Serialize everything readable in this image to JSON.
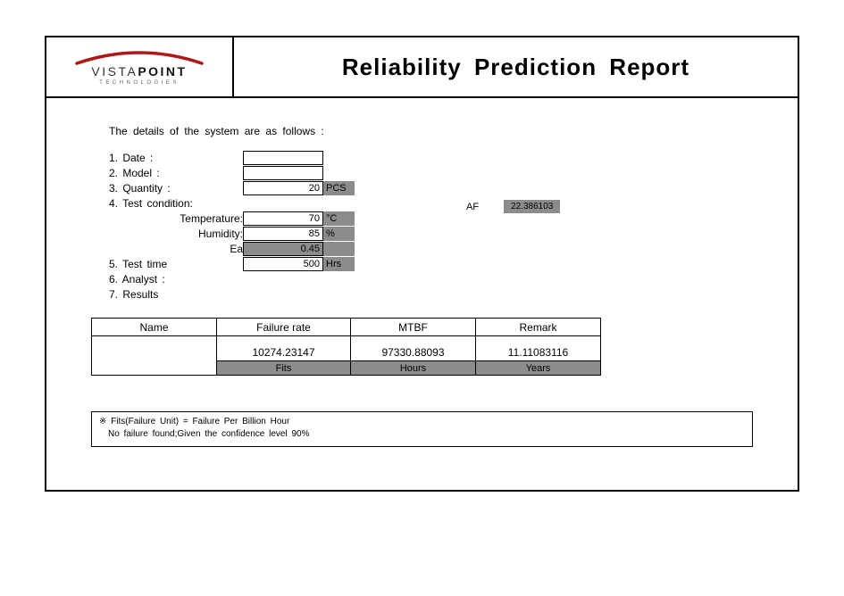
{
  "logo": {
    "brand_prefix": "VISTA",
    "brand_suffix": "POINT",
    "sub": "TECHNOLOGIES"
  },
  "title": "Reliability Prediction Report",
  "intro": "The details of the system are as follows :",
  "details": {
    "date": {
      "label": "1. Date :",
      "value": ""
    },
    "model": {
      "label": "2. Model :",
      "value": ""
    },
    "quantity": {
      "label": "3. Quantity :",
      "value": "20",
      "unit": "PCS"
    },
    "testcond": {
      "label": "4. Test condition:"
    },
    "temperature": {
      "label": "Temperature:",
      "value": "70",
      "unit": "°C"
    },
    "humidity": {
      "label": "Humidity:",
      "value": "85",
      "unit": "%"
    },
    "ea": {
      "label": "Ea",
      "value": "0.45"
    },
    "testtime": {
      "label": "5. Test time",
      "value": "500",
      "unit": "Hrs"
    },
    "analyst": {
      "label": "6. Analyst :"
    },
    "results": {
      "label": "7. Results"
    },
    "af": {
      "label": "AF",
      "value": "22.386103"
    }
  },
  "table": {
    "headers": {
      "name": "Name",
      "failure": "Failure rate",
      "mtbf": "MTBF",
      "remark": "Remark"
    },
    "values": {
      "name": "",
      "failure": "10274.23147",
      "mtbf": "97330.88093",
      "remark": "11.11083116"
    },
    "units": {
      "name": "",
      "failure": "Fits",
      "mtbf": "Hours",
      "remark": "Years"
    }
  },
  "footnote": {
    "line1": "※ Fits(Failure Unit) = Failure Per Billion Hour",
    "line2": "No failure found;Given the confidence level 90%"
  }
}
